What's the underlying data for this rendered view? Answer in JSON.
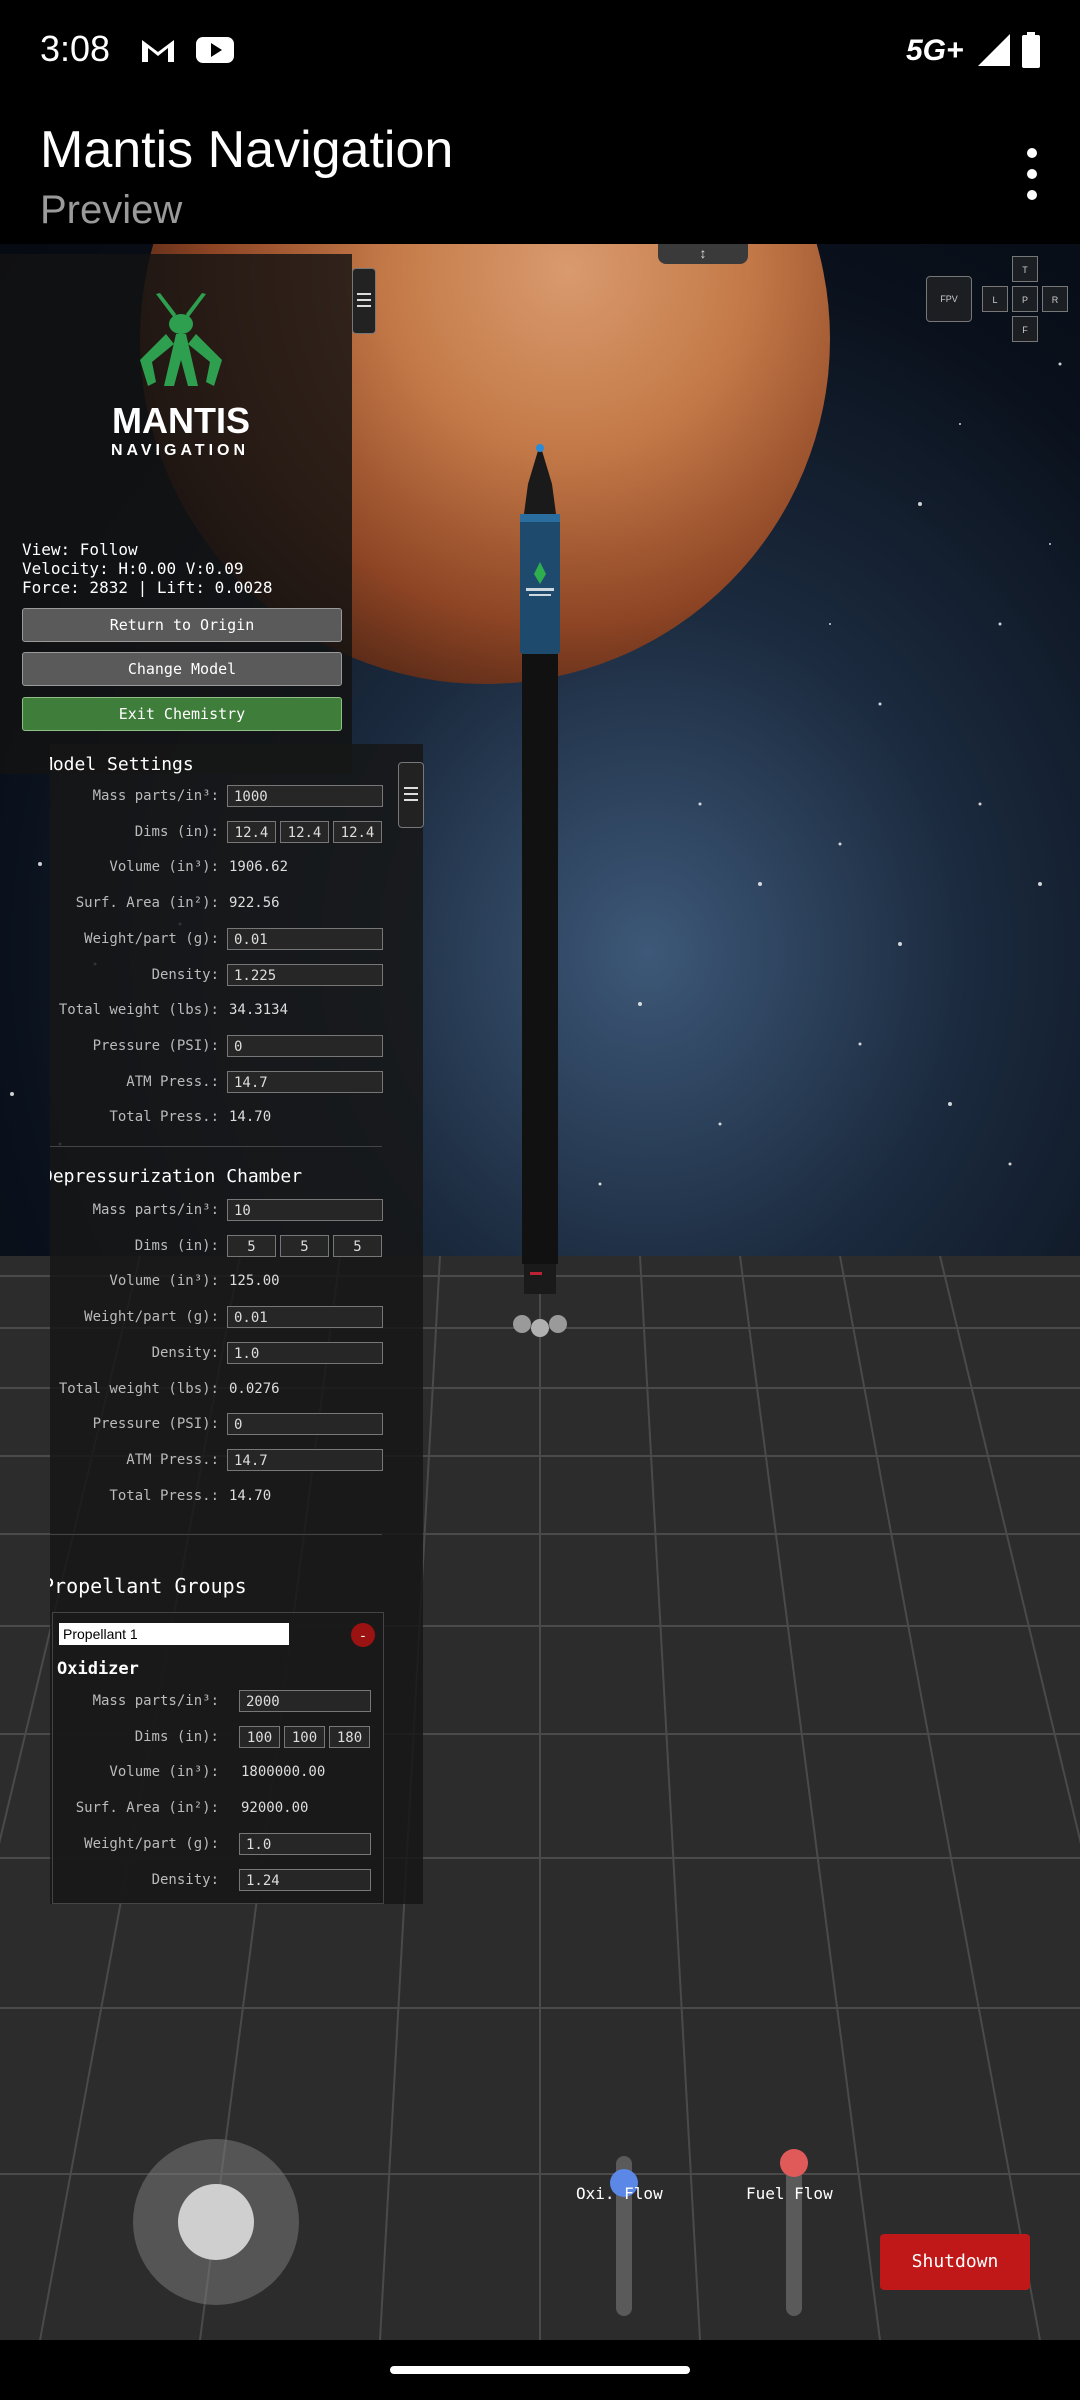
{
  "status": {
    "time": "3:08",
    "network": "5G+"
  },
  "appbar": {
    "title": "Mantis Navigation",
    "subtitle": "Preview"
  },
  "logo": {
    "name": "MANTIS",
    "sub": "NAVIGATION"
  },
  "hud": {
    "view": "View: Follow",
    "velocity": "Velocity: H:0.00 V:0.09",
    "force": "Force: 2832 | Lift: 0.0028",
    "buttons": [
      "Return to Origin",
      "Change Model",
      "Exit Chemistry"
    ]
  },
  "camera": {
    "fpv": "FPV",
    "top": "T",
    "left": "L",
    "persp": "P",
    "right": "R",
    "front": "F"
  },
  "top_handle": "↕",
  "model_settings": {
    "title": "Model Settings",
    "rows": [
      {
        "label": "Mass parts/in³:",
        "field": "1000"
      },
      {
        "label": "Dims (in):",
        "dims": [
          "12.4",
          "12.4",
          "12.4"
        ]
      },
      {
        "label": "Volume (in³):",
        "value": "1906.62"
      },
      {
        "label": "Surf. Area (in²):",
        "value": "922.56"
      },
      {
        "label": "Weight/part (g):",
        "field": "0.01"
      },
      {
        "label": "Density:",
        "field": "1.225"
      },
      {
        "label": "Total weight (lbs):",
        "value": "34.3134"
      },
      {
        "label": "Pressure (PSI):",
        "field": "0"
      },
      {
        "label": "ATM Press.:",
        "field": "14.7"
      },
      {
        "label": "Total Press.:",
        "value": "14.70"
      }
    ]
  },
  "depressurization": {
    "title": "Depressurization Chamber",
    "rows": [
      {
        "label": "Mass parts/in³:",
        "field": "10"
      },
      {
        "label": "Dims (in):",
        "dims": [
          "5",
          "5",
          "5"
        ]
      },
      {
        "label": "Volume (in³):",
        "value": "125.00"
      },
      {
        "label": "Weight/part (g):",
        "field": "0.01"
      },
      {
        "label": "Density:",
        "field": "1.0"
      },
      {
        "label": "Total weight (lbs):",
        "value": "0.0276"
      },
      {
        "label": "Pressure (PSI):",
        "field": "0"
      },
      {
        "label": "ATM Press.:",
        "field": "14.7"
      },
      {
        "label": "Total Press.:",
        "value": "14.70"
      }
    ]
  },
  "propellant": {
    "title": "Propellant Groups",
    "name": "Propellant 1",
    "remove_label": "-",
    "section": "Oxidizer",
    "rows": [
      {
        "label": "Mass parts/in³:",
        "field": "2000"
      },
      {
        "label": "Dims (in):",
        "dims": [
          "100",
          "100",
          "180"
        ]
      },
      {
        "label": "Volume (in³):",
        "value": "1800000.00"
      },
      {
        "label": "Surf. Area (in²):",
        "value": "92000.00"
      },
      {
        "label": "Weight/part (g):",
        "field": "1.0"
      },
      {
        "label": "Density:",
        "field": "1.24"
      }
    ]
  },
  "controls": {
    "oxi_label": "Oxi. Flow",
    "fuel_label": "Fuel Flow",
    "shutdown": "Shutdown",
    "oxi_color": "#5b87e6",
    "fuel_color": "#e05a5a"
  }
}
